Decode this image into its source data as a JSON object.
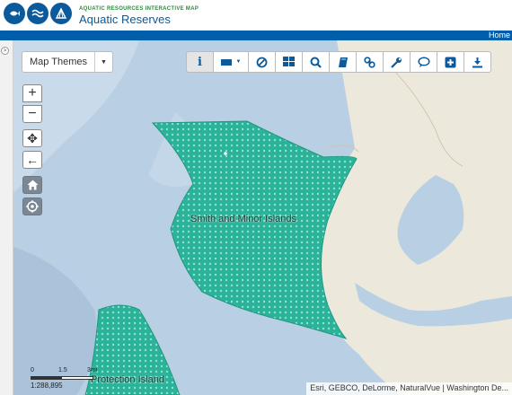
{
  "header": {
    "subtitle": "AQUATIC RESOURCES INTERACTIVE MAP",
    "title": "Aquatic Reserves",
    "logo_icons": [
      "fish-icon",
      "wave-icon",
      "shell-icon"
    ],
    "brand_color": "#0b5a9c"
  },
  "nav": {
    "home_link": "Home",
    "bar_color": "#005eab"
  },
  "map_themes": {
    "label": "Map Themes"
  },
  "toolbar": {
    "buttons": [
      {
        "icon": "info-icon",
        "active": true
      },
      {
        "icon": "rectangle-select-icon",
        "has_dropdown": true
      },
      {
        "icon": "clear-icon"
      },
      {
        "icon": "grid-icon"
      },
      {
        "icon": "search-icon"
      },
      {
        "icon": "book-icon"
      },
      {
        "icon": "link-icon"
      },
      {
        "icon": "wrench-icon"
      },
      {
        "icon": "comment-icon"
      },
      {
        "icon": "add-icon"
      },
      {
        "icon": "download-icon"
      }
    ]
  },
  "controls": {
    "zoom_in": "+",
    "zoom_out": "−",
    "pan": "✥",
    "back": "←",
    "home_icon": "home-icon",
    "locate_icon": "locate-icon"
  },
  "map": {
    "labels": {
      "reserve_1": "Smith and Minor Islands",
      "reserve_2": "Protection Island"
    },
    "reserve_color": "#2bb39a",
    "water_color": "#b9cfe3",
    "land_color": "#ece9dc"
  },
  "scale": {
    "ticks": [
      "0",
      "1.5",
      "3mi"
    ],
    "ratio": "1:288,895"
  },
  "attribution": "Esri, GEBCO, DeLorme, NaturalVue | Washington De..."
}
